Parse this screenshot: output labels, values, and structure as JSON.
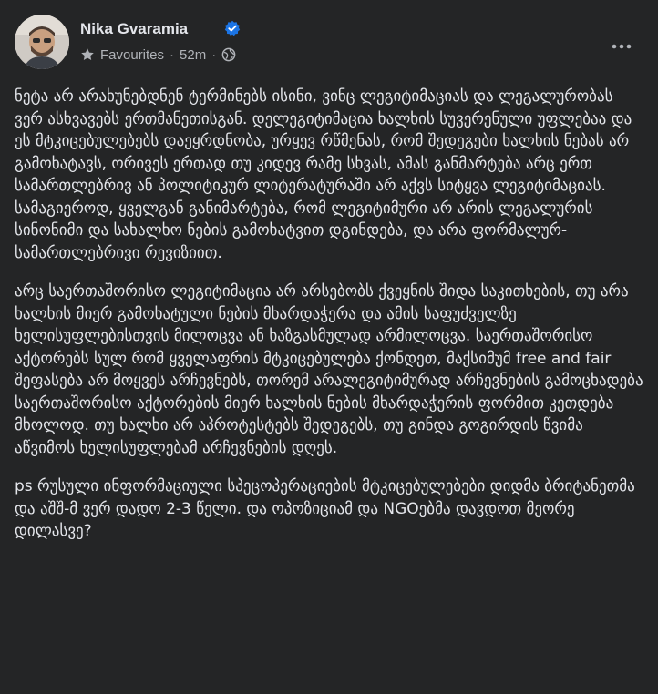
{
  "post": {
    "author": "Nika Gvaramia",
    "audience": "Favourites",
    "time": "52m",
    "paragraphs": [
      "ნეტა არ არახუნებდნენ ტერმინებს ისინი, ვინც ლეგიტიმაციას და ლეგალურობას ვერ ასხვავებს ერთმანეთისგან. დელეგიტიმაცია ხალხის სუვერენული უფლებაა და ეს მტკიცებულებებს დაეყრდნობა, ურყევ რწმენას, რომ შედეგები ხალხის ნებას არ გამოხატავს, ორივეს ერთად თუ კიდევ რამე სხვას, ამას განმარტება არც ერთ სამართლებრივ ან პოლიტიკურ ლიტერატურაში არ აქვს სიტყვა ლეგიტიმაციას. სამაგიეროდ, ყველგან განიმარტება, რომ ლეგიტიმური არ არის ლეგალურის სინონიმი და სახალხო ნების გამოხატვით დგინდება, და არა ფორმალურ-სამართლებრივი რევიზიით.",
      "არც საერთაშორისო ლეგიტიმაცია არ არსებობს ქვეყნის შიდა საკითხების, თუ არა ხალხის მიერ გამოხატული ნების მხარდაჭერა და ამის საფუძველზე ხელისუფლებისთვის მილოცვა ან ხაზგასმულად არმილოცვა. საერთაშორისო აქტორებს სულ რომ ყველაფრის მტკიცებულება ქონდეთ, მაქსიმუმ free and fair შეფასება არ მოყვეს არჩევნებს, თორემ არალეგიტიმურად არჩევნების გამოცხადება საერთაშორისო აქტორების მიერ ხალხის ნების მხარდაჭერის ფორმით კეთდება მხოლოდ. თუ ხალხი არ აპროტესტებს შედეგებს, თუ გინდა გოგირდის წვიმა აწვიმოს ხელისუფლებამ არჩევნების დღეს.",
      "ps რუსული ინფორმაციული სპეცოპერაციების მტკიცებულებები დიდმა ბრიტანეთმა და აშშ-მ ვერ დადო 2-3 წელი. და ოპოზიციამ და NGOებმა დავდოთ მეორე დილასვე?"
    ]
  },
  "icons": {
    "verified": "verified-badge-icon",
    "audience": "star-icon",
    "privacy": "globe-icon",
    "more": "more-dots-icon"
  },
  "colors": {
    "background": "#242526",
    "text": "#e4e6eb",
    "secondary_text": "#b0b3b8",
    "verified": "#1b74e4"
  }
}
